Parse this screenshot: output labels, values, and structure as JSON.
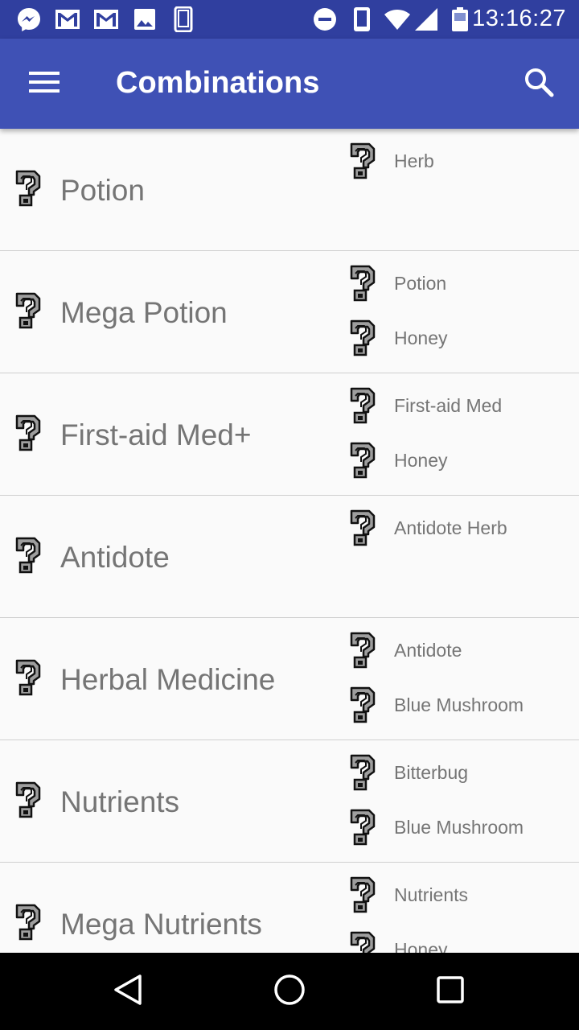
{
  "status_bar": {
    "time": "13:16:27",
    "left_icons": [
      "messenger-icon",
      "gmail-icon",
      "gmail-icon",
      "photo-icon",
      "phone-outline-icon"
    ],
    "right_icons": [
      "do-not-disturb-icon",
      "phone-icon",
      "wifi-icon",
      "cell-signal-icon",
      "battery-icon"
    ]
  },
  "app_bar": {
    "title": "Combinations",
    "menu_icon": "hamburger-menu-icon",
    "search_icon": "search-icon"
  },
  "colors": {
    "status_bar": "#303f9f",
    "app_bar": "#3f51b5",
    "text_secondary": "#757575",
    "divider": "#cfcfcf",
    "background": "#fafafa"
  },
  "item_icon": "unknown-item-icon",
  "combinations": [
    {
      "result": "Potion",
      "ingredients": [
        "Herb"
      ]
    },
    {
      "result": "Mega Potion",
      "ingredients": [
        "Potion",
        "Honey"
      ]
    },
    {
      "result": "First-aid Med+",
      "ingredients": [
        "First-aid Med",
        "Honey"
      ]
    },
    {
      "result": "Antidote",
      "ingredients": [
        "Antidote Herb"
      ]
    },
    {
      "result": "Herbal Medicine",
      "ingredients": [
        "Antidote",
        "Blue Mushroom"
      ]
    },
    {
      "result": "Nutrients",
      "ingredients": [
        "Bitterbug",
        "Blue Mushroom"
      ]
    },
    {
      "result": "Mega Nutrients",
      "ingredients": [
        "Nutrients",
        "Honey"
      ]
    }
  ],
  "nav_bar": {
    "back_icon": "back-icon",
    "home_icon": "home-icon",
    "recents_icon": "recents-icon"
  }
}
